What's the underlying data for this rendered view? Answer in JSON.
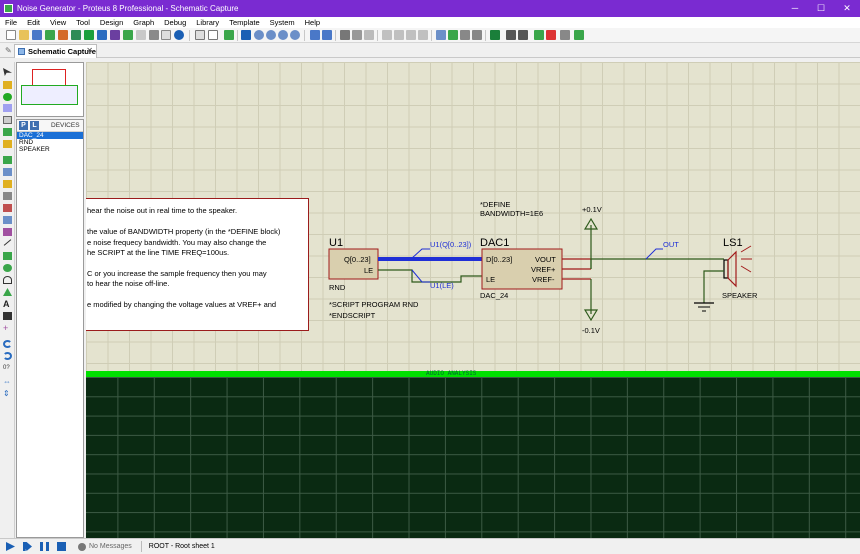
{
  "window": {
    "title": "Noise Generator - Proteus 8 Professional - Schematic Capture",
    "minimize": "─",
    "maximize": "☐",
    "close": "✕"
  },
  "menu": [
    "File",
    "Edit",
    "View",
    "Tool",
    "Design",
    "Graph",
    "Debug",
    "Library",
    "Template",
    "System",
    "Help"
  ],
  "tab": {
    "label": "Schematic Capture",
    "close": "✕",
    "pin": "✎"
  },
  "devices": {
    "p_button": "P",
    "l_button": "L",
    "title": "DEVICES",
    "items": [
      "DAC_24",
      "RND",
      "SPEAKER"
    ],
    "selected": 0
  },
  "note": {
    "lines": [
      "hear the noise out in real time to the speaker.",
      "the value of BANDWIDTH property (in the *DEFINE block)",
      "e noise frequecy bandwidth. You may also change the",
      "he SCRIPT at the line TIME FREQ=100us.",
      "C or you increase the sample frequency then you may",
      "to hear the noise off-line.",
      "e modified by changing the voltage values at VREF+ and"
    ]
  },
  "schematic": {
    "u1": {
      "ref": "U1",
      "pin_q": "Q[0..23]",
      "pin_le": "LE",
      "type": "RND",
      "script1": "*SCRIPT PROGRAM RND",
      "script2": "*ENDSCRIPT"
    },
    "dac1": {
      "ref": "DAC1",
      "pin_d": "D[0..23]",
      "pin_le": "LE",
      "pin_vout": "VOUT",
      "pin_vrefp": "VREF+",
      "pin_vrefm": "VREF-",
      "type": "DAC_24",
      "define1": "*DEFINE",
      "define2": "BANDWIDTH=1E6"
    },
    "probes": {
      "bus": "U1(Q[0..23])",
      "le": "U1(LE)",
      "out": "OUT"
    },
    "power": {
      "pos": "+0.1V",
      "neg": "-0.1V"
    },
    "ls1": {
      "ref": "LS1",
      "type": "SPEAKER"
    }
  },
  "graph": {
    "label": "AUDIO ANALYSIS"
  },
  "status": {
    "messages": "No Messages",
    "sheet": "ROOT - Root sheet 1"
  },
  "colors": {
    "title_bar": "#7a2bd1",
    "wire": "#2d5a1b",
    "bus": "#1f2fd6",
    "component_fill": "#d9cfae",
    "component_border": "#a11a1a",
    "graph_bg": "#0a2a12",
    "graph_border": "#00e000"
  }
}
